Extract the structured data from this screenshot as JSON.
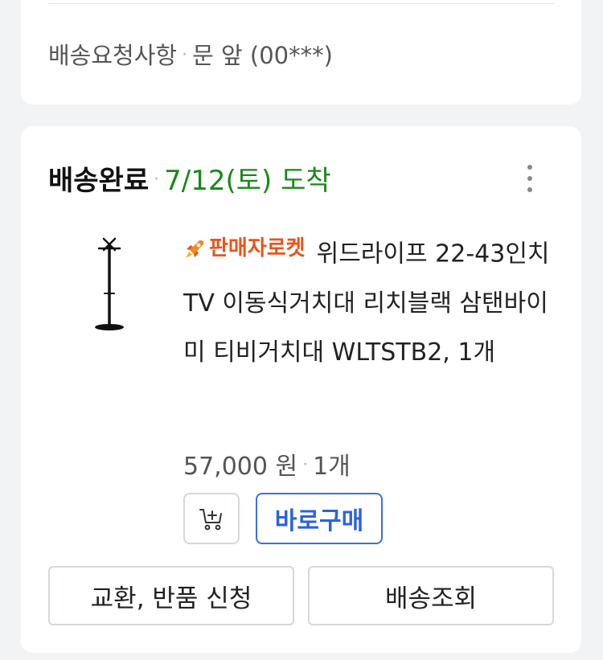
{
  "top_card": {
    "delivery_request_label": "배송요청사항",
    "separator": "·",
    "delivery_request_value": "문 앞 (00***)"
  },
  "order": {
    "status": "배송완료",
    "separator": "·",
    "arrival": "7/12(토) 도착",
    "more_icon": "more-vertical-icon",
    "product": {
      "image_icon": "tv-stand-image",
      "badge": "판매자로켓",
      "badge_icon": "rocket-icon",
      "badge_color": "#e8551d",
      "title": "위드라이프 22-43인치TV 이동식거치대 리치블랙 삼탠바이미 티비거치대 WLTSTB2, 1개",
      "price": "57,000 원",
      "quantity": "1개"
    },
    "cart_button_icon": "add-to-cart-icon",
    "buy_button_label": "바로구매",
    "exchange_button_label": "교환, 반품 신청",
    "tracking_button_label": "배송조회",
    "colors": {
      "arrival": "#178a17",
      "buy_button": "#2b62e0"
    }
  }
}
